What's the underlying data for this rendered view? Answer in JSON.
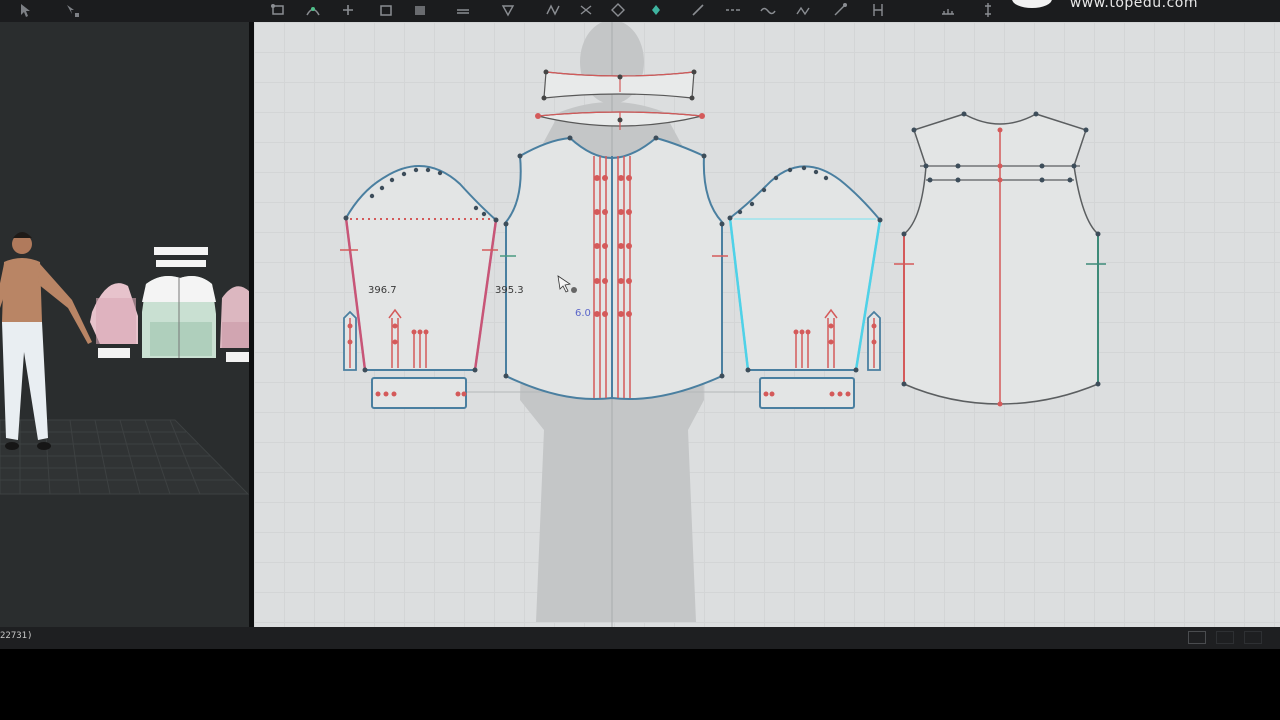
{
  "app": {
    "watermark_text": "www.topedu.com",
    "accent_color": "#e04545",
    "selected_edge_color": "#4fd2e8",
    "seam_color": "#4a7fa0"
  },
  "toolbar": {
    "icons": [
      "select-icon",
      "transform-icon",
      "edit-point-icon",
      "curve-point-icon",
      "add-point-icon",
      "rectangle-icon",
      "polygon-icon",
      "internal-line-icon",
      "dart-icon",
      "pleat-icon",
      "fold-icon",
      "trace-icon",
      "symmetric-icon",
      "sewing-icon",
      "segment-sewing-icon",
      "free-sewing-icon",
      "tack-icon",
      "pin-icon",
      "elastic-icon"
    ]
  },
  "viewport3d": {
    "avatar": "male-avatar",
    "garment_label": "3D garment preview"
  },
  "pattern_window": {
    "measurements": {
      "left_sleeve_length": "396.7",
      "front_edge_length": "395.3",
      "active_length": "6.0"
    }
  },
  "status_bar": {
    "text": "22731)"
  }
}
